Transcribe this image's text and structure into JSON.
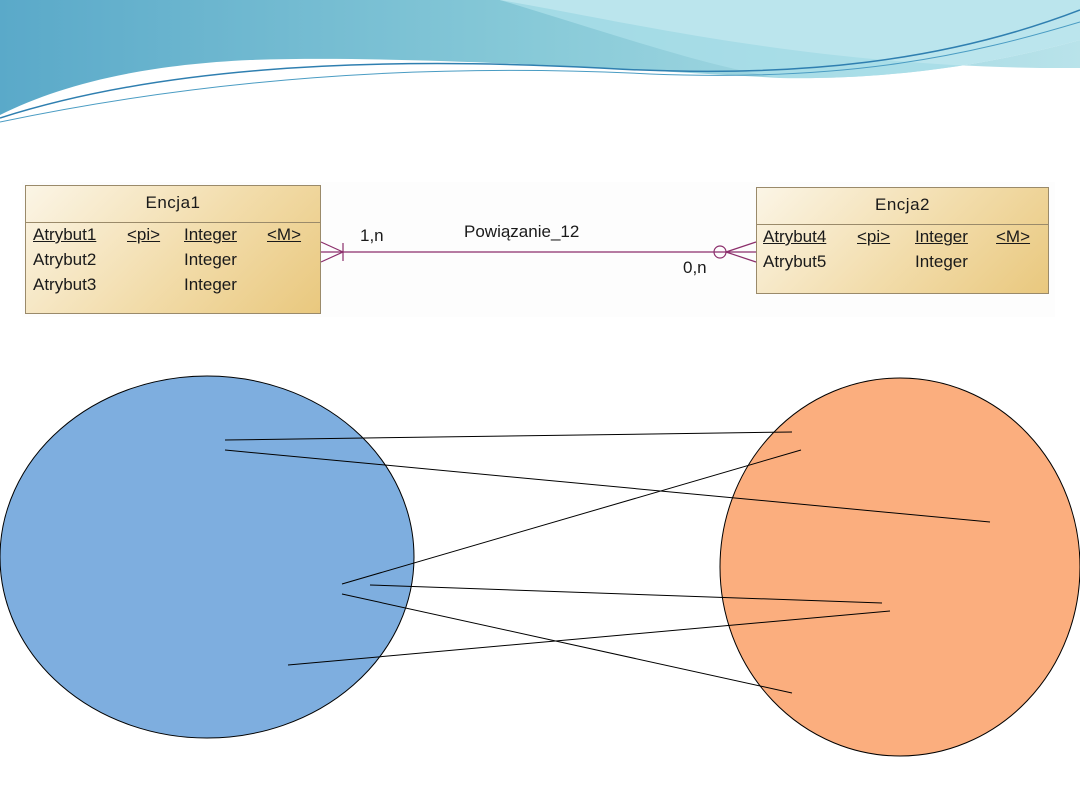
{
  "er_diagram": {
    "entity1": {
      "name": "Encja1",
      "attributes": [
        {
          "name": "Atrybut1",
          "key": "<pi>",
          "type": "Integer",
          "mandatory": "<M>"
        },
        {
          "name": "Atrybut2",
          "key": "",
          "type": "Integer",
          "mandatory": ""
        },
        {
          "name": "Atrybut3",
          "key": "",
          "type": "Integer",
          "mandatory": ""
        }
      ]
    },
    "entity2": {
      "name": "Encja2",
      "attributes": [
        {
          "name": "Atrybut4",
          "key": "<pi>",
          "type": "Integer",
          "mandatory": "<M>"
        },
        {
          "name": "Atrybut5",
          "key": "",
          "type": "Integer",
          "mandatory": ""
        }
      ]
    },
    "relationship": {
      "name": "Powiązanie_12",
      "cardinality_left": "1,n",
      "cardinality_right": "0,n"
    }
  },
  "colors": {
    "entity_fill": "#f2dcaa",
    "relationship_line": "#8b2e6b",
    "set_left_fill": "#7eaedf",
    "set_right_fill": "#fbae7e",
    "header_wave": "#7cc3d6"
  }
}
